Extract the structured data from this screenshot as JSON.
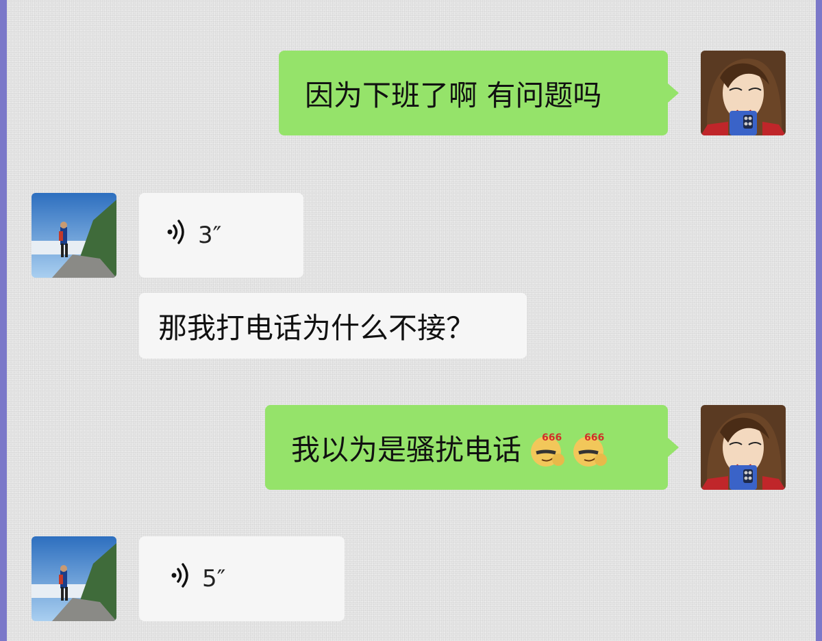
{
  "messages": [
    {
      "side": "right",
      "type": "text",
      "text": "因为下班了啊 有问题吗"
    },
    {
      "side": "left",
      "type": "voice",
      "duration": "3″"
    },
    {
      "side": "left",
      "type": "text",
      "text": "那我打电话为什么不接？"
    },
    {
      "side": "right",
      "type": "text",
      "text": "我以为是骚扰电话",
      "emojis": [
        "666-sunglasses-emoji",
        "666-sunglasses-emoji"
      ]
    },
    {
      "side": "left",
      "type": "voice",
      "duration": "5″"
    }
  ],
  "colors": {
    "sent_bubble": "#95e36a",
    "received_bubble": "#f6f6f6",
    "chat_background": "#e6e6e6",
    "frame": "#7b78c9"
  }
}
